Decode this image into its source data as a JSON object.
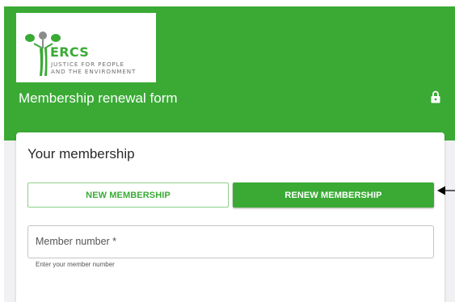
{
  "header": {
    "logo": {
      "name": "ERCS",
      "tagline_line1": "JUSTICE FOR PEOPLE",
      "tagline_line2": "AND THE ENVIRONMENT"
    },
    "form_title": "Membership renewal form",
    "lock_icon": "lock-icon"
  },
  "membership": {
    "title": "Your membership",
    "new_button": "NEW MEMBERSHIP",
    "renew_button": "RENEW MEMBERSHIP",
    "selected": "RENEW MEMBERSHIP",
    "member_number": {
      "label": "Member number *",
      "value": "",
      "helper": "Enter your member number"
    }
  },
  "annotation": {
    "arrow_icon": "arrow-left-icon"
  },
  "colors": {
    "brand_green": "#3aaa35",
    "logo_gray": "#6d6e70",
    "background": "#f1f1f3"
  }
}
